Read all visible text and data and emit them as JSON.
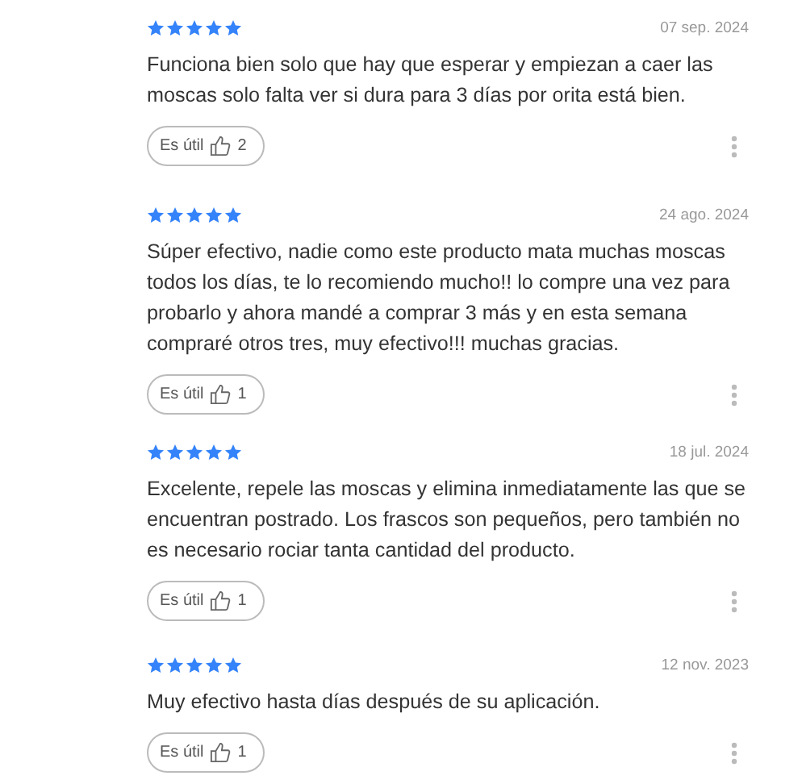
{
  "reviews": [
    {
      "stars": 5,
      "date": "07 sep. 2024",
      "text": "Funciona bien solo que hay que esperar y empiezan a caer las moscas solo falta ver si dura para 3 días por orita está bien.",
      "helpful_label": "Es útil",
      "helpful_count": "2"
    },
    {
      "stars": 5,
      "date": "24 ago. 2024",
      "text": "Súper efectivo, nadie como este producto mata muchas moscas todos los días, te lo recomiendo mucho!! lo compre una vez para probarlo y ahora mandé a comprar 3 más y en esta semana compraré otros tres, muy efectivo!!! muchas gracias.",
      "helpful_label": "Es útil",
      "helpful_count": "1"
    },
    {
      "stars": 5,
      "date": "18 jul. 2024",
      "text": "Excelente, repele las moscas y elimina inmediatamente las que se encuentran postrado. Los frascos son pequeños, pero también no es necesario rociar tanta cantidad del producto.",
      "helpful_label": "Es útil",
      "helpful_count": "1"
    },
    {
      "stars": 5,
      "date": "12 nov. 2023",
      "text": "Muy efectivo hasta días después de su aplicación.",
      "helpful_label": "Es útil",
      "helpful_count": "1"
    }
  ]
}
